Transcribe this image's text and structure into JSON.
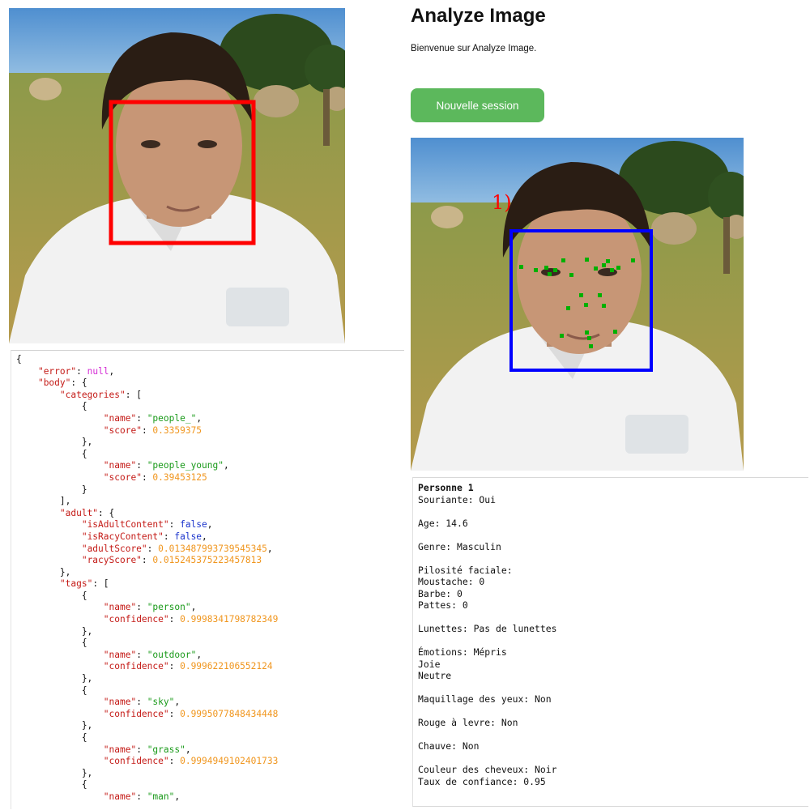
{
  "app": {
    "title": "Analyze Image",
    "welcome": "Bienvenue sur Analyze Image.",
    "new_session_label": "Nouvelle session"
  },
  "colors": {
    "button": "#5cb85c",
    "face_box_left": "#ff0000",
    "face_box_right": "#0000ff",
    "landmarks": "#00b000",
    "face_index_label": "#ff0000"
  },
  "images": {
    "left_description": "photo-with-red-face-rectangle",
    "right_face_label": "1)"
  },
  "json_lines": [
    [
      [
        "p",
        "{"
      ]
    ],
    [
      [
        "p",
        "    "
      ],
      [
        "k",
        "\"error\""
      ],
      [
        "p",
        ": "
      ],
      [
        "n",
        "null"
      ],
      [
        "p",
        ","
      ]
    ],
    [
      [
        "p",
        "    "
      ],
      [
        "k",
        "\"body\""
      ],
      [
        "p",
        ": {"
      ]
    ],
    [
      [
        "p",
        "        "
      ],
      [
        "k",
        "\"categories\""
      ],
      [
        "p",
        ": ["
      ]
    ],
    [
      [
        "p",
        "            {"
      ]
    ],
    [
      [
        "p",
        "                "
      ],
      [
        "k",
        "\"name\""
      ],
      [
        "p",
        ": "
      ],
      [
        "s",
        "\"people_\""
      ],
      [
        "p",
        ","
      ]
    ],
    [
      [
        "p",
        "                "
      ],
      [
        "k",
        "\"score\""
      ],
      [
        "p",
        ": "
      ],
      [
        "num",
        "0.3359375"
      ]
    ],
    [
      [
        "p",
        "            },"
      ]
    ],
    [
      [
        "p",
        "            {"
      ]
    ],
    [
      [
        "p",
        "                "
      ],
      [
        "k",
        "\"name\""
      ],
      [
        "p",
        ": "
      ],
      [
        "s",
        "\"people_young\""
      ],
      [
        "p",
        ","
      ]
    ],
    [
      [
        "p",
        "                "
      ],
      [
        "k",
        "\"score\""
      ],
      [
        "p",
        ": "
      ],
      [
        "num",
        "0.39453125"
      ]
    ],
    [
      [
        "p",
        "            }"
      ]
    ],
    [
      [
        "p",
        "        ],"
      ]
    ],
    [
      [
        "p",
        "        "
      ],
      [
        "k",
        "\"adult\""
      ],
      [
        "p",
        ": {"
      ]
    ],
    [
      [
        "p",
        "            "
      ],
      [
        "k",
        "\"isAdultContent\""
      ],
      [
        "p",
        ": "
      ],
      [
        "b",
        "false"
      ],
      [
        "p",
        ","
      ]
    ],
    [
      [
        "p",
        "            "
      ],
      [
        "k",
        "\"isRacyContent\""
      ],
      [
        "p",
        ": "
      ],
      [
        "b",
        "false"
      ],
      [
        "p",
        ","
      ]
    ],
    [
      [
        "p",
        "            "
      ],
      [
        "k",
        "\"adultScore\""
      ],
      [
        "p",
        ": "
      ],
      [
        "num",
        "0.013487993739545345"
      ],
      [
        "p",
        ","
      ]
    ],
    [
      [
        "p",
        "            "
      ],
      [
        "k",
        "\"racyScore\""
      ],
      [
        "p",
        ": "
      ],
      [
        "num",
        "0.015245375223457813"
      ]
    ],
    [
      [
        "p",
        "        },"
      ]
    ],
    [
      [
        "p",
        "        "
      ],
      [
        "k",
        "\"tags\""
      ],
      [
        "p",
        ": ["
      ]
    ],
    [
      [
        "p",
        "            {"
      ]
    ],
    [
      [
        "p",
        "                "
      ],
      [
        "k",
        "\"name\""
      ],
      [
        "p",
        ": "
      ],
      [
        "s",
        "\"person\""
      ],
      [
        "p",
        ","
      ]
    ],
    [
      [
        "p",
        "                "
      ],
      [
        "k",
        "\"confidence\""
      ],
      [
        "p",
        ": "
      ],
      [
        "num",
        "0.9998341798782349"
      ]
    ],
    [
      [
        "p",
        "            },"
      ]
    ],
    [
      [
        "p",
        "            {"
      ]
    ],
    [
      [
        "p",
        "                "
      ],
      [
        "k",
        "\"name\""
      ],
      [
        "p",
        ": "
      ],
      [
        "s",
        "\"outdoor\""
      ],
      [
        "p",
        ","
      ]
    ],
    [
      [
        "p",
        "                "
      ],
      [
        "k",
        "\"confidence\""
      ],
      [
        "p",
        ": "
      ],
      [
        "num",
        "0.999622106552124"
      ]
    ],
    [
      [
        "p",
        "            },"
      ]
    ],
    [
      [
        "p",
        "            {"
      ]
    ],
    [
      [
        "p",
        "                "
      ],
      [
        "k",
        "\"name\""
      ],
      [
        "p",
        ": "
      ],
      [
        "s",
        "\"sky\""
      ],
      [
        "p",
        ","
      ]
    ],
    [
      [
        "p",
        "                "
      ],
      [
        "k",
        "\"confidence\""
      ],
      [
        "p",
        ": "
      ],
      [
        "num",
        "0.9995077848434448"
      ]
    ],
    [
      [
        "p",
        "            },"
      ]
    ],
    [
      [
        "p",
        "            {"
      ]
    ],
    [
      [
        "p",
        "                "
      ],
      [
        "k",
        "\"name\""
      ],
      [
        "p",
        ": "
      ],
      [
        "s",
        "\"grass\""
      ],
      [
        "p",
        ","
      ]
    ],
    [
      [
        "p",
        "                "
      ],
      [
        "k",
        "\"confidence\""
      ],
      [
        "p",
        ": "
      ],
      [
        "num",
        "0.9994949102401733"
      ]
    ],
    [
      [
        "p",
        "            },"
      ]
    ],
    [
      [
        "p",
        "            {"
      ]
    ],
    [
      [
        "p",
        "                "
      ],
      [
        "k",
        "\"name\""
      ],
      [
        "p",
        ": "
      ],
      [
        "s",
        "\"man\""
      ],
      [
        "p",
        ","
      ]
    ]
  ],
  "result": {
    "person_title": "Personne 1",
    "smiling": "Souriante: Oui",
    "age": "Age: 14.6",
    "gender": "Genre: Masculin",
    "facial_hair_title": "Pilosité faciale:",
    "moustache": "Moustache: 0",
    "beard": "Barbe: 0",
    "sideburns": "Pattes: 0",
    "glasses": "Lunettes: Pas de lunettes",
    "emotions_title": "Émotions: Mépris",
    "emotion_2": "Joie",
    "emotion_3": "Neutre",
    "eye_makeup": "Maquillage des yeux: Non",
    "lip_makeup": "Rouge à levre: Non",
    "bald": "Chauve: Non",
    "hair_color": "Couleur des cheveux: Noir",
    "confidence": "Taux de confiance: 0.95"
  }
}
